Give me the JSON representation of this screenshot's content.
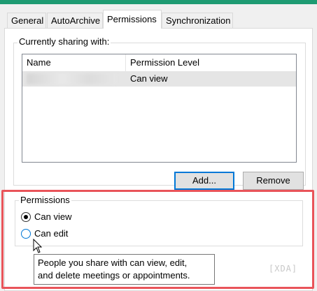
{
  "tabs": [
    {
      "label": "General",
      "active": false
    },
    {
      "label": "AutoArchive",
      "active": false
    },
    {
      "label": "Permissions",
      "active": true
    },
    {
      "label": "Synchronization",
      "active": false
    }
  ],
  "sharing": {
    "title": "Currently sharing with:",
    "columns": {
      "name": "Name",
      "permission": "Permission Level"
    },
    "rows": [
      {
        "name": "",
        "permission": "Can view",
        "selected": true
      }
    ]
  },
  "buttons": {
    "add": "Add...",
    "remove": "Remove"
  },
  "permissions": {
    "title": "Permissions",
    "options": [
      {
        "label": "Can view",
        "checked": true
      },
      {
        "label": "Can edit",
        "checked": false
      }
    ]
  },
  "tooltip": {
    "line1": "People you share with can view, edit,",
    "line2": "and delete meetings or appointments."
  },
  "watermark": "XDA",
  "colors": {
    "accent": "#0078d7",
    "highlight_box": "#e9545a",
    "top_bar": "#1e9b72"
  }
}
